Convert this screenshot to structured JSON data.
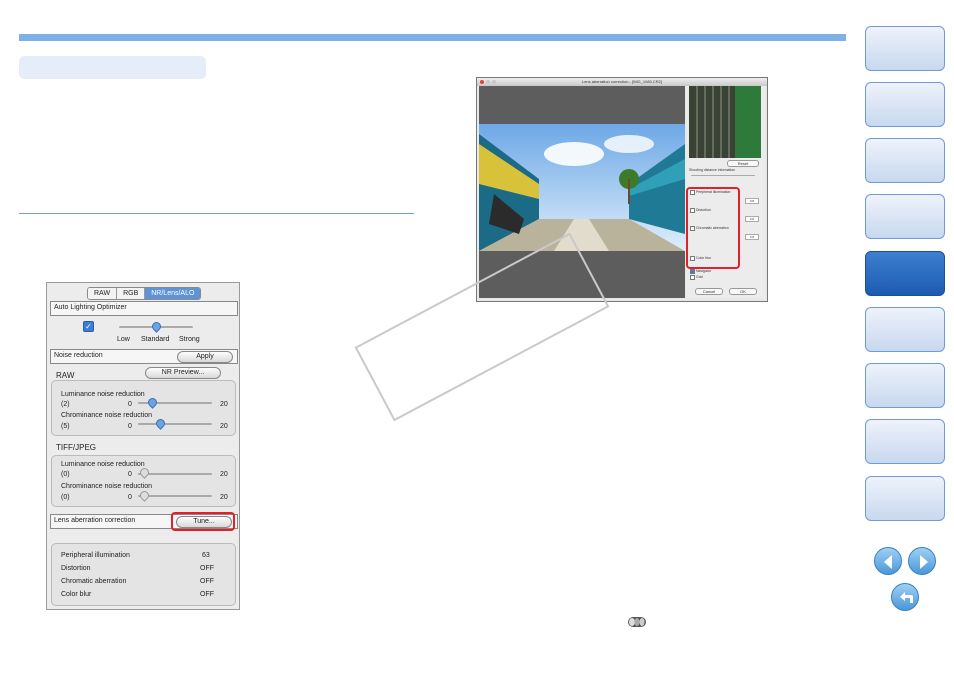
{
  "left_panel": {
    "tabs": [
      "RAW",
      "RGB",
      "NR/Lens/ALO"
    ],
    "alo": {
      "title": "Auto Lighting Optimizer",
      "levels": [
        "Low",
        "Standard",
        "Strong"
      ],
      "checked": true,
      "selected": "Standard"
    },
    "noise_reduction": {
      "title": "Noise reduction",
      "apply": "Apply",
      "preview": "NR Preview...",
      "raw_title": "RAW",
      "tiff_title": "TIFF/JPEG",
      "luminance_label": "Luminance noise reduction",
      "chrominance_label": "Chrominance noise reduction",
      "min": "0",
      "max": "20",
      "raw_lum_value": "(2)",
      "raw_chrom_value": "(5)",
      "tiff_lum_value": "(0)",
      "tiff_chrom_value": "(0)"
    },
    "lens": {
      "title": "Lens aberration correction",
      "tune": "Tune...",
      "rows": [
        {
          "label": "Peripheral illumination",
          "value": "63"
        },
        {
          "label": "Distortion",
          "value": "OFF"
        },
        {
          "label": "Chromatic aberration",
          "value": "OFF"
        },
        {
          "label": "Color blur",
          "value": "OFF"
        }
      ]
    }
  },
  "dialog": {
    "title": "Lens aberration correction - [IMG_1083.CR2]",
    "reset": "Reset",
    "shooting_distance": "Shooting distance information",
    "options": [
      "Peripheral illumination",
      "Distortion",
      "Chromatic aberration",
      "Color blur"
    ],
    "values": [
      "0.8",
      "0.8",
      "0.8"
    ],
    "navigator": "Navigator",
    "grid": "Grid",
    "cancel": "Cancel",
    "ok": "OK"
  },
  "nav": {
    "buttons": 9,
    "active_index": 4
  },
  "colors": {
    "accent": "#7fb0e6",
    "highlight": "#e0202a",
    "nav_active": "#2a69c0"
  }
}
